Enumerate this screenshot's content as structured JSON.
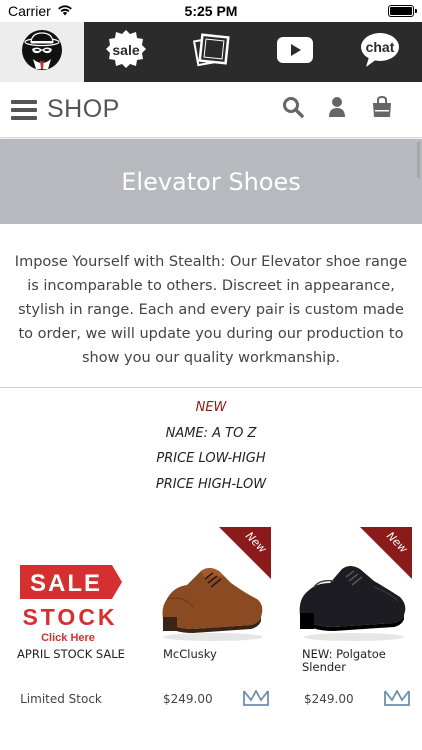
{
  "status_bar": {
    "carrier": "Carrier",
    "time": "5:25 PM"
  },
  "icon_bar": {
    "items": [
      {
        "icon": "spy-logo-icon",
        "label": ""
      },
      {
        "icon": "sale-badge-icon",
        "label": "sale"
      },
      {
        "icon": "photos-icon",
        "label": ""
      },
      {
        "icon": "video-play-icon",
        "label": ""
      },
      {
        "icon": "chat-bubble-icon",
        "label": "chat"
      }
    ]
  },
  "nav": {
    "title": "SHOP",
    "actions": [
      "search-icon",
      "account-icon",
      "cart-icon"
    ]
  },
  "banner": {
    "title": "Elevator Shoes"
  },
  "description": {
    "text": "Impose Yourself with Stealth: Our Elevator shoe range is incomparable to others. Discreet in appearance, stylish in range. Each and every pair is custom made to order, we will update you during our production to show you our quality workmanship."
  },
  "sort_options": {
    "items": [
      "NEW",
      "NAME: A TO Z",
      "PRICE LOW-HIGH",
      "PRICE HIGH-LOW"
    ],
    "active": "NEW"
  },
  "products": [
    {
      "name": "APRIL STOCK SALE",
      "price": "Limited Stock",
      "badge": "",
      "image_text": {
        "sale": "SALE",
        "stock": "STOCK",
        "cta": "Click Here"
      }
    },
    {
      "name": "McClusky",
      "price": "$249.00",
      "badge": "New",
      "shoe_color": "#8a4a22"
    },
    {
      "name": "NEW: Polgatoe Slender",
      "price": "$249.00",
      "badge": "New",
      "shoe_color": "#1c1c22"
    }
  ],
  "colors": {
    "accent": "#8b1a1a",
    "icon_bar": "#2b2b2b",
    "banner": "#b8b8bf"
  }
}
